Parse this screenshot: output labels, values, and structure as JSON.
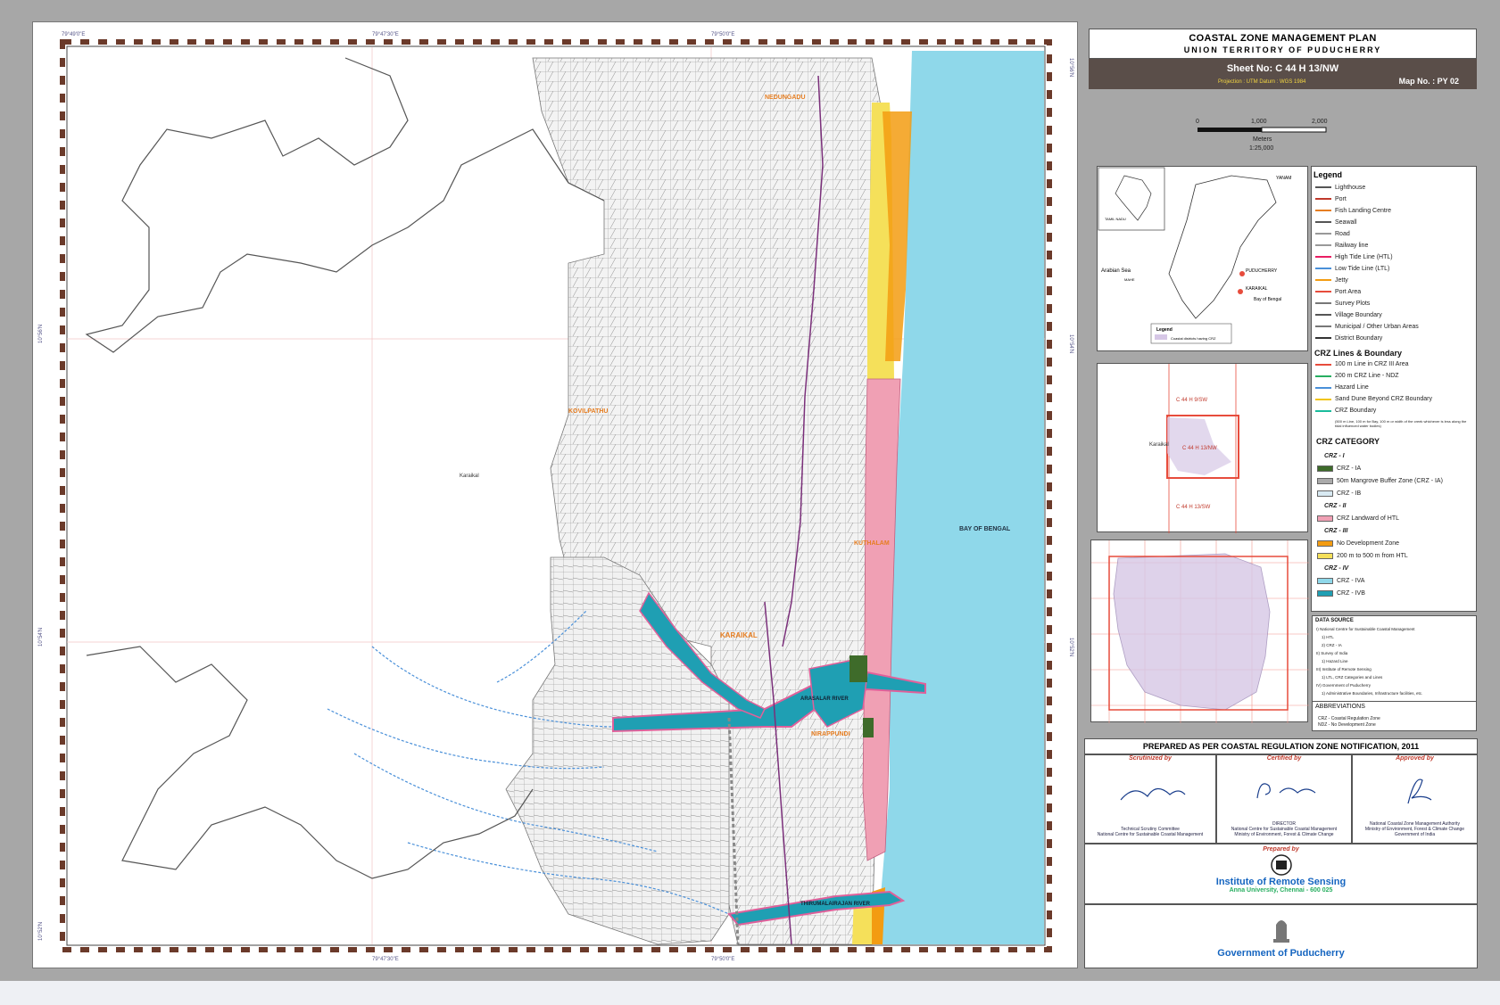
{
  "title": {
    "main": "COASTAL ZONE MANAGEMENT PLAN",
    "sub": "UNION TERRITORY OF PUDUCHERRY",
    "sheet_no": "Sheet No: C 44 H 13/NW",
    "projection": "Projection : UTM     Datum : WGS 1984",
    "map_no": "Map No. : PY 02"
  },
  "scale": {
    "ticks": [
      "0",
      "1,000",
      "2,000"
    ],
    "unit": "Meters",
    "ratio": "1:25,000"
  },
  "map_labels": {
    "bay": "BAY OF BENGAL",
    "karaikal_town": "KARAIKAL",
    "karaikal_dist": "Karaikal",
    "kovilpathu": "KOVILPATHU",
    "kuthalam": "KUTHALAM",
    "nirappundi": "NIRAPPUNDI",
    "arasalar": "ARASALAR RIVER",
    "thirumalairajan": "THIRUMALAIRAJAN RIVER",
    "north_village": "NEDUNGADU"
  },
  "coords": {
    "top": [
      "79°49'0\"E",
      "79°47'30\"E",
      "79°50'0\"E"
    ],
    "bottom": [
      "79°47'30\"E",
      "79°50'0\"E"
    ],
    "left": [
      "10°56'N",
      "10°54'N",
      "10°52'N"
    ],
    "right": [
      "10°56'N",
      "10°54'N",
      "10°52'N"
    ]
  },
  "inset_india": {
    "labels": [
      "Arabian Sea",
      "Bay of Bengal",
      "PUDUCHERRY",
      "KARAIKAL",
      "YANAM",
      "MAHE",
      "TAMIL NADU"
    ],
    "legend_title": "Legend",
    "legend_item": "Coastal districts having CRZ"
  },
  "inset_index": {
    "labels": [
      "C 44 H 9/SW",
      "C 44 H 13/NW",
      "C 44 H 13/SW",
      "Karaikal"
    ]
  },
  "legend": {
    "title": "Legend",
    "items": [
      "Lighthouse",
      "Port",
      "Fish Landing Centre",
      "Seawall",
      "Road",
      "Railway line",
      "High Tide Line (HTL)",
      "Low Tide Line (LTL)",
      "Jetty",
      "Port Area",
      "Survey Plots",
      "Village Boundary",
      "Municipal / Other Urban Areas",
      "District Boundary"
    ],
    "crz_lines_title": "CRZ  Lines & Boundary",
    "crz_lines": [
      "100 m Line in CRZ III Area",
      "200 m CRZ Line - NDZ",
      "Hazard Line",
      "Sand Dune Beyond CRZ Boundary",
      "CRZ Boundary"
    ],
    "crz_note": "(500 m Line, 100 m for Bay, 100 m or width of the creek whichever is less along the tidal influenced water bodies)",
    "category_title": "CRZ CATEGORY",
    "crz1_title": "CRZ - I",
    "crz1": [
      "CRZ - IA",
      "50m Mangrove Buffer Zone (CRZ - IA)",
      "CRZ - IB"
    ],
    "crz2_title": "CRZ - II",
    "crz2": [
      "CRZ Landward of HTL"
    ],
    "crz3_title": "CRZ - III",
    "crz3": [
      "No Development Zone",
      "200 m to 500 m from HTL"
    ],
    "crz4_title": "CRZ - IV",
    "crz4": [
      "CRZ - IVA",
      "CRZ - IVB"
    ],
    "colors": {
      "crz_ia": "#3e6b2a",
      "crz_ib": "#d8e9f2",
      "crz_ii": "#f0a0b4",
      "ndz": "#f39c12",
      "crz_iii": "#f5e05a",
      "crz_iva": "#8fd8ea",
      "crz_ivb": "#1f9fb3"
    }
  },
  "data_source": {
    "title": "DATA SOURCE",
    "lines": [
      "I) National Centre for Sustainable Coastal Management",
      "1) HTL",
      "2) CRZ - IA",
      "II) Survey of India",
      "1) Hazard Line",
      "III) Institute of Remote Sensing",
      "1) LTL, CRZ Categories and Lines",
      "IV) Government of Puducherry",
      "1) Administrative Boundaries, Infrastructure facilities, etc."
    ]
  },
  "abbreviations": {
    "title": "ABBREVIATIONS",
    "lines": [
      "CRZ    -   Coastal Regulation Zone",
      "NDZ    -   No Development Zone"
    ]
  },
  "prepared_note": "PREPARED AS PER COASTAL REGULATION ZONE NOTIFICATION, 2011",
  "signatures": {
    "scrutinized": {
      "head": "Scrutinized by",
      "body": [
        "Technical Scrutiny Committee",
        "National Centre for Sustainable Coastal Management"
      ]
    },
    "certified": {
      "head": "Certified by",
      "body": [
        "DIRECTOR",
        "National Centre for Sustainable Coastal Management",
        "Ministry of Environment, Forest & Climate Change"
      ]
    },
    "approved": {
      "head": "Approved by",
      "body": [
        "National Coastal Zone Management Authority",
        "Ministry of Environment, Forest & Climate Change",
        "Government of India"
      ]
    }
  },
  "prepared_by": {
    "head": "Prepared by",
    "org": "Institute of Remote Sensing",
    "addr": "Anna University, Chennai - 600 025"
  },
  "govt": "Government of Puducherry"
}
